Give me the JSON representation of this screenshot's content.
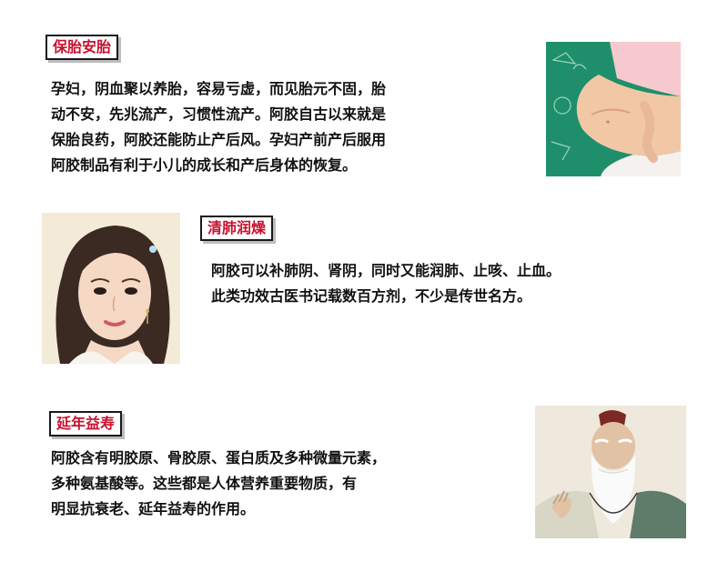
{
  "sections": [
    {
      "title": "保胎安胎",
      "lines": [
        "孕妇，阴血聚以养胎，容易亏虚，而见胎元不固，胎",
        "动不安，先兆流产，习惯性流产。阿胶自古以来就是",
        "保胎良药，阿胶还能防止产后风。孕妇产前产后服用",
        "阿胶制品有利于小儿的成长和产后身体的恢复。"
      ],
      "image_icon": "pregnant-belly-image"
    },
    {
      "title": "清肺润燥",
      "lines": [
        "阿胶可以补肺阴、肾阴，同时又能润肺、止咳、止血。",
        "此类功效古医书记载数百方剂，不少是传世名方。"
      ],
      "image_icon": "woman-portrait-image"
    },
    {
      "title": "延年益寿",
      "lines": [
        "阿胶含有明胶原、骨胶原、蛋白质及多种微量元素，",
        "多种氨基酸等。这些都是人体营养重要物质，有",
        "明显抗衰老、延年益寿的作用。"
      ],
      "image_icon": "elder-portrait-image"
    }
  ],
  "colors": {
    "title_text": "#c8102e",
    "body_text": "#111111",
    "green_backdrop": "#1f8f6b"
  }
}
